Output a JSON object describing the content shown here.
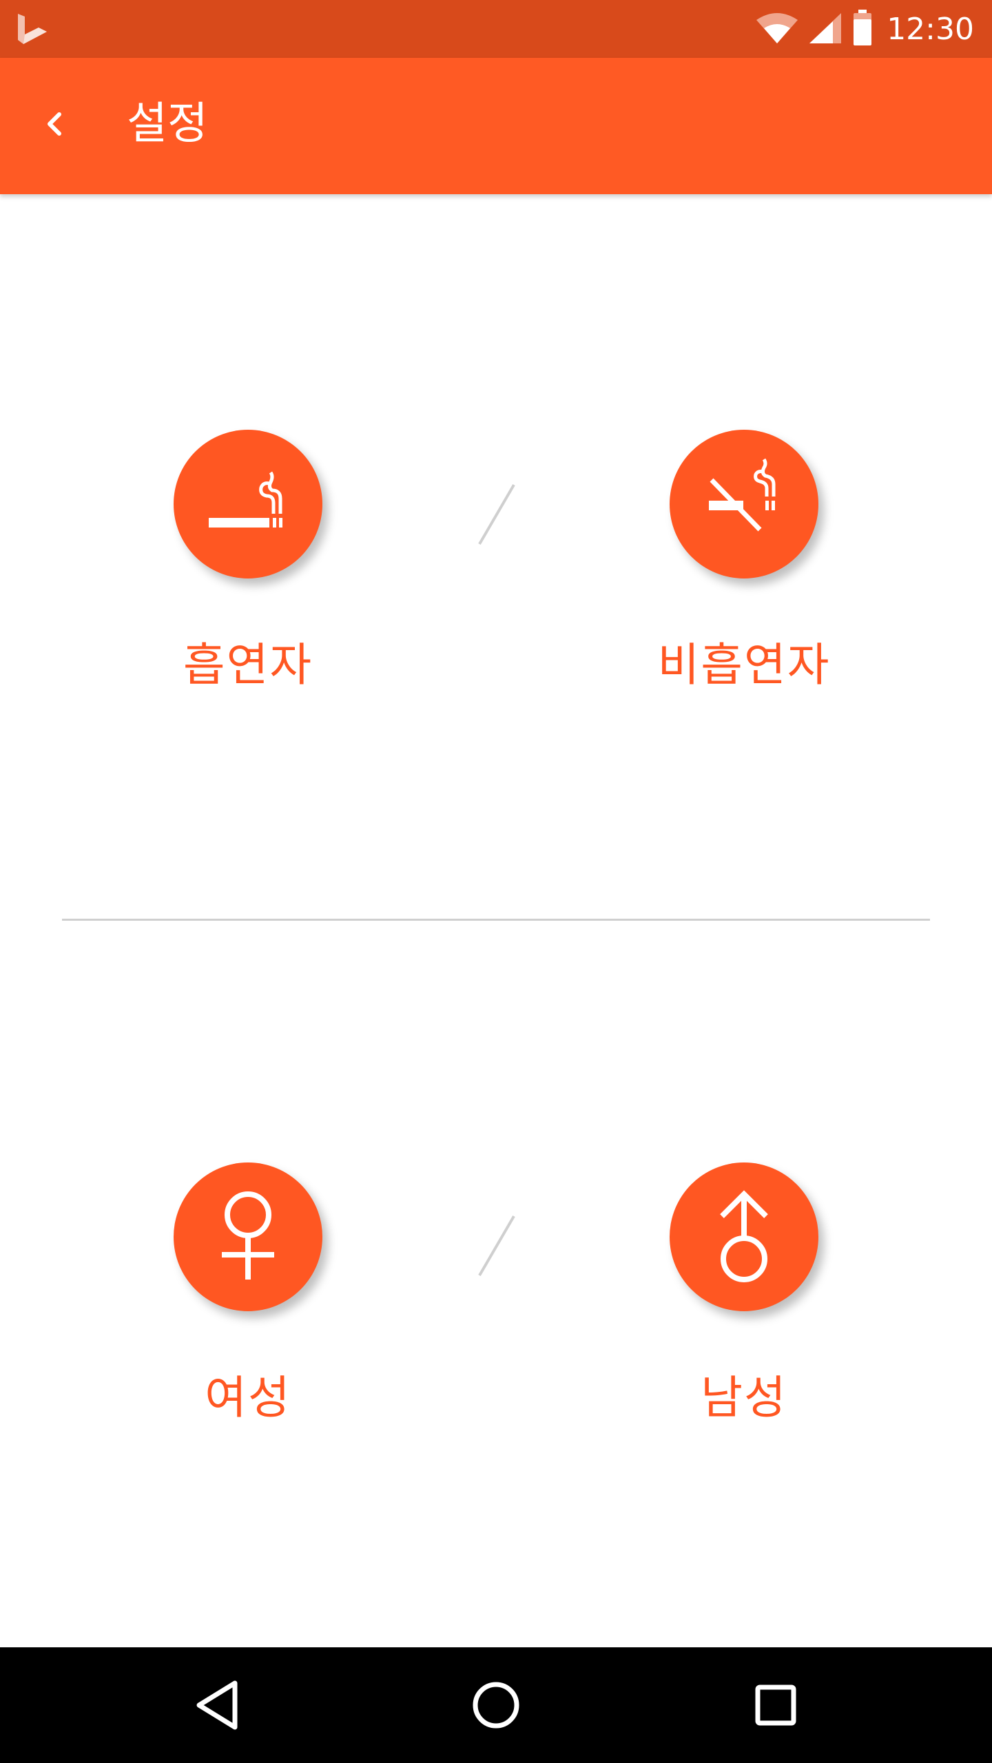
{
  "status_bar": {
    "time": "12:30",
    "icons": [
      "bing-logo-icon",
      "wifi-icon",
      "cell-signal-icon",
      "battery-icon"
    ]
  },
  "app_bar": {
    "title": "설정",
    "back_icon": "chevron-left-icon"
  },
  "smoking": {
    "smoker": {
      "label": "흡연자",
      "icon": "smoking-icon"
    },
    "non_smoker": {
      "label": "비흡연자",
      "icon": "no-smoking-icon"
    }
  },
  "gender": {
    "female": {
      "label": "여성",
      "icon": "female-icon"
    },
    "male": {
      "label": "남성",
      "icon": "male-icon"
    }
  },
  "nav_bar": {
    "icons": [
      "back-triangle-icon",
      "home-circle-icon",
      "recents-square-icon"
    ]
  },
  "colors": {
    "status_bar": "#d84a1b",
    "app_bar": "#ff5a24",
    "accent": "#ff5722",
    "divider": "#cfcfcf"
  }
}
